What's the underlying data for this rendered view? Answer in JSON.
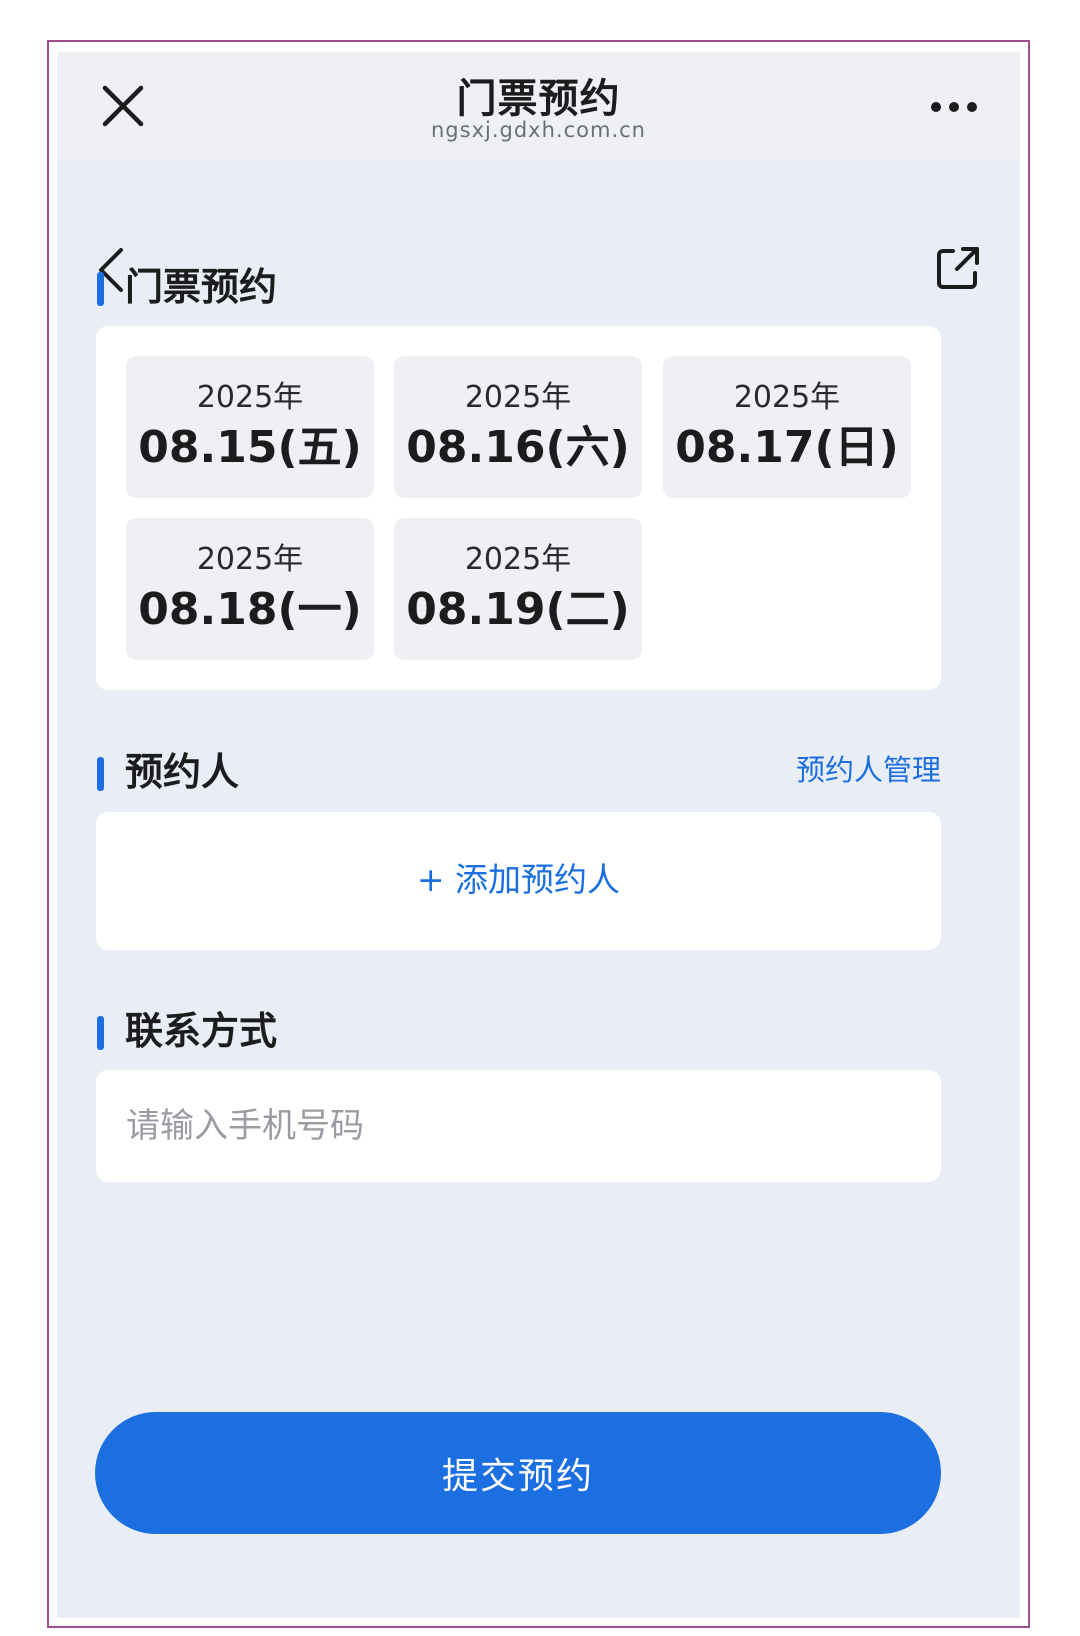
{
  "browser": {
    "title": "门票预约",
    "url": "ngsxj.gdxh.com.cn",
    "close_icon": "close-icon",
    "more_icon": "more-horizontal-icon"
  },
  "nav": {
    "back_icon": "chevron-left-icon",
    "share_icon": "external-share-icon"
  },
  "sections": {
    "tickets": {
      "title": "门票预约",
      "dates": [
        {
          "year": "2025年",
          "date": "08.15(五)"
        },
        {
          "year": "2025年",
          "date": "08.16(六)"
        },
        {
          "year": "2025年",
          "date": "08.17(日)"
        },
        {
          "year": "2025年",
          "date": "08.18(一)"
        },
        {
          "year": "2025年",
          "date": "08.19(二)"
        }
      ]
    },
    "visitor": {
      "title": "预约人",
      "manage_label": "预约人管理",
      "add_label": "+ 添加预约人"
    },
    "contact": {
      "title": "联系方式",
      "phone_value": "",
      "phone_placeholder": "请输入手机号码"
    }
  },
  "submit_label": "提交预约",
  "colors": {
    "accent": "#1b6fe0",
    "background": "#e9eef6",
    "card": "#ffffff",
    "tile": "#eef0f3"
  }
}
